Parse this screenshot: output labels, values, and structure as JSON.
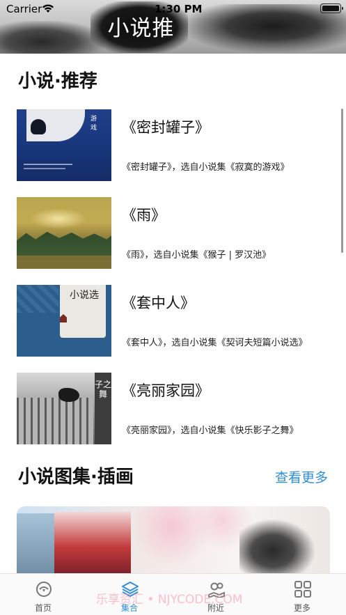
{
  "status_bar": {
    "carrier": "Carrier",
    "time": "1:30 PM"
  },
  "header": {
    "banner_title": "小说推荐"
  },
  "sections": {
    "recommend_title": "小说·推荐",
    "gallery_title": "小说图集·插画",
    "gallery_more": "查看更多"
  },
  "novels": [
    {
      "title": "《密封罐子》",
      "desc": "《密封罐子》，选自小说集《寂寞的游戏》",
      "cover_text": "游戏"
    },
    {
      "title": "《雨》",
      "desc": "《雨》，选自小说集《猴子 | 罗汉池》",
      "cover_text": ""
    },
    {
      "title": "《套中人》",
      "desc": "《套中人》，选自小说集《契诃夫短篇小说选》",
      "cover_text": "小说选"
    },
    {
      "title": "《亮丽家园》",
      "desc": "《亮丽家园》，选自小说集《快乐影子之舞》",
      "cover_text": "子之舞"
    }
  ],
  "tabs": [
    {
      "label": "首页",
      "icon": "home-icon",
      "active": false
    },
    {
      "label": "集合",
      "icon": "layers-icon",
      "active": true
    },
    {
      "label": "附近",
      "icon": "map-pin-icon",
      "active": false
    },
    {
      "label": "更多",
      "icon": "grid-icon",
      "active": false
    }
  ],
  "watermark": "乐享资汇 • NJYCODE.COM",
  "colors": {
    "accent": "#2f8fd8",
    "text": "#111111"
  }
}
